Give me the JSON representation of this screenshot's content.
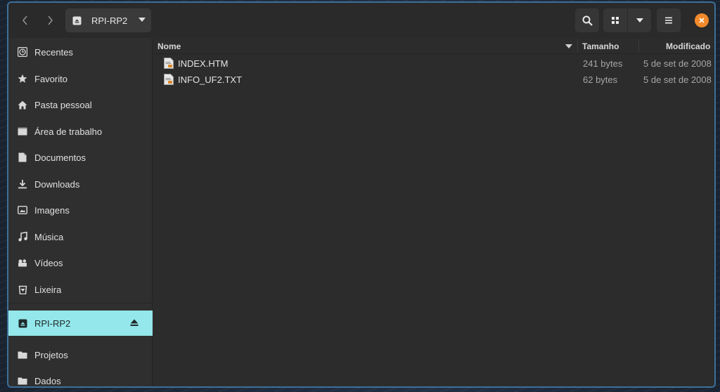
{
  "window": {
    "location": "RPI-RP2"
  },
  "sidebar": {
    "items": [
      {
        "label": "Recentes",
        "icon": "clock-icon"
      },
      {
        "label": "Favorito",
        "icon": "star-icon"
      },
      {
        "label": "Pasta pessoal",
        "icon": "home-icon"
      },
      {
        "label": "Área de trabalho",
        "icon": "desktop-icon"
      },
      {
        "label": "Documentos",
        "icon": "document-icon"
      },
      {
        "label": "Downloads",
        "icon": "download-icon"
      },
      {
        "label": "Imagens",
        "icon": "image-icon"
      },
      {
        "label": "Música",
        "icon": "music-icon"
      },
      {
        "label": "Vídeos",
        "icon": "video-icon"
      },
      {
        "label": "Lixeira",
        "icon": "trash-icon"
      }
    ],
    "devices": [
      {
        "label": "RPI-RP2",
        "icon": "drive-icon",
        "active": true
      }
    ],
    "bookmarks": [
      {
        "label": "Projetos",
        "icon": "folder-icon"
      },
      {
        "label": "Dados",
        "icon": "folder-icon"
      }
    ]
  },
  "list": {
    "columns": {
      "name": "Nome",
      "size": "Tamanho",
      "modified": "Modificado"
    },
    "files": [
      {
        "name": "INDEX.HTM",
        "size": "241 bytes",
        "modified": "5 de set de 2008"
      },
      {
        "name": "INFO_UF2.TXT",
        "size": "62 bytes",
        "modified": "5 de set de 2008"
      }
    ]
  },
  "colors": {
    "accent": "#94e7ea",
    "close": "#f28a2b",
    "window_border": "#3d6f99"
  }
}
